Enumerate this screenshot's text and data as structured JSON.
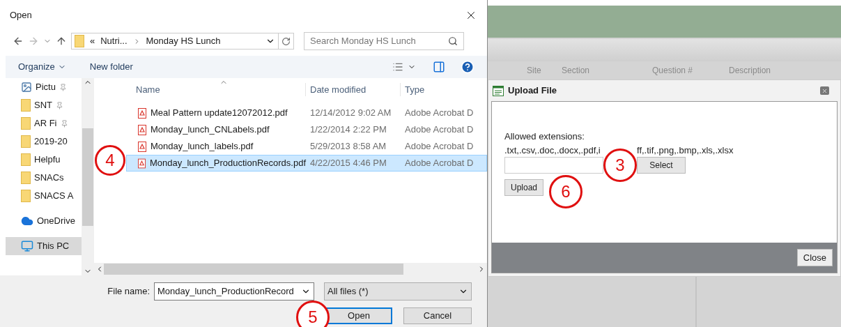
{
  "open_dialog": {
    "title": "Open",
    "path": [
      "«",
      "Nutri...",
      "Monday HS Lunch"
    ],
    "search": {
      "placeholder": "Search Monday HS Lunch"
    },
    "toolbar": {
      "organize": "Organize",
      "new_folder": "New folder"
    },
    "sidebar": {
      "items": [
        {
          "label": "Pictu",
          "kind": "pictures",
          "pinned": true,
          "selected": false
        },
        {
          "label": "SNT",
          "kind": "folder",
          "pinned": true,
          "selected": false
        },
        {
          "label": "AR Fi",
          "kind": "folder",
          "pinned": true,
          "selected": false
        },
        {
          "label": "2019-20",
          "kind": "folder",
          "pinned": false,
          "selected": false
        },
        {
          "label": "Helpfu",
          "kind": "folder",
          "pinned": false,
          "selected": false
        },
        {
          "label": "SNACs",
          "kind": "folder",
          "pinned": false,
          "selected": false
        },
        {
          "label": "SNACS A",
          "kind": "folder",
          "pinned": false,
          "selected": false
        },
        {
          "label": "OneDrive",
          "kind": "cloud",
          "pinned": false,
          "selected": false
        },
        {
          "label": "This PC",
          "kind": "pc",
          "pinned": false,
          "selected": true
        }
      ]
    },
    "columns": [
      "Name",
      "Date modified",
      "Type"
    ],
    "rows": [
      {
        "name": "Meal Pattern update12072012.pdf",
        "date": "12/14/2012 9:02 AM",
        "type": "Adobe Acrobat D",
        "selected": false
      },
      {
        "name": "Monday_lunch_CNLabels.pdf",
        "date": "1/22/2014 2:22 PM",
        "type": "Adobe Acrobat D",
        "selected": false
      },
      {
        "name": "Monday_lunch_labels.pdf",
        "date": "5/29/2013 8:58 AM",
        "type": "Adobe Acrobat D",
        "selected": false
      },
      {
        "name": "Monday_lunch_ProductionRecords.pdf",
        "date": "4/22/2015 4:46 PM",
        "type": "Adobe Acrobat D",
        "selected": true
      }
    ],
    "file_name_label": "File name:",
    "file_name": "Monday_lunch_ProductionRecord",
    "file_type": "All files (*)",
    "open_button": "Open",
    "cancel_button": "Cancel"
  },
  "background_page": {
    "columns": [
      "Site",
      "Section",
      "Question #",
      "Description"
    ]
  },
  "upload_dialog": {
    "title": "Upload File",
    "allowed_label": "Allowed extensions:",
    "extensions_before": ".txt,.csv,.doc,.docx,.pdf,i",
    "extensions_after": "ff,.tif,.png,.bmp,.xls,.xlsx",
    "select_button": "Select",
    "upload_button": "Upload",
    "close_button": "Close"
  },
  "callouts": [
    {
      "label": "4",
      "kind": "file"
    },
    {
      "label": "5",
      "kind": "open"
    },
    {
      "label": "3",
      "kind": "select"
    },
    {
      "label": "6",
      "kind": "upload"
    }
  ]
}
